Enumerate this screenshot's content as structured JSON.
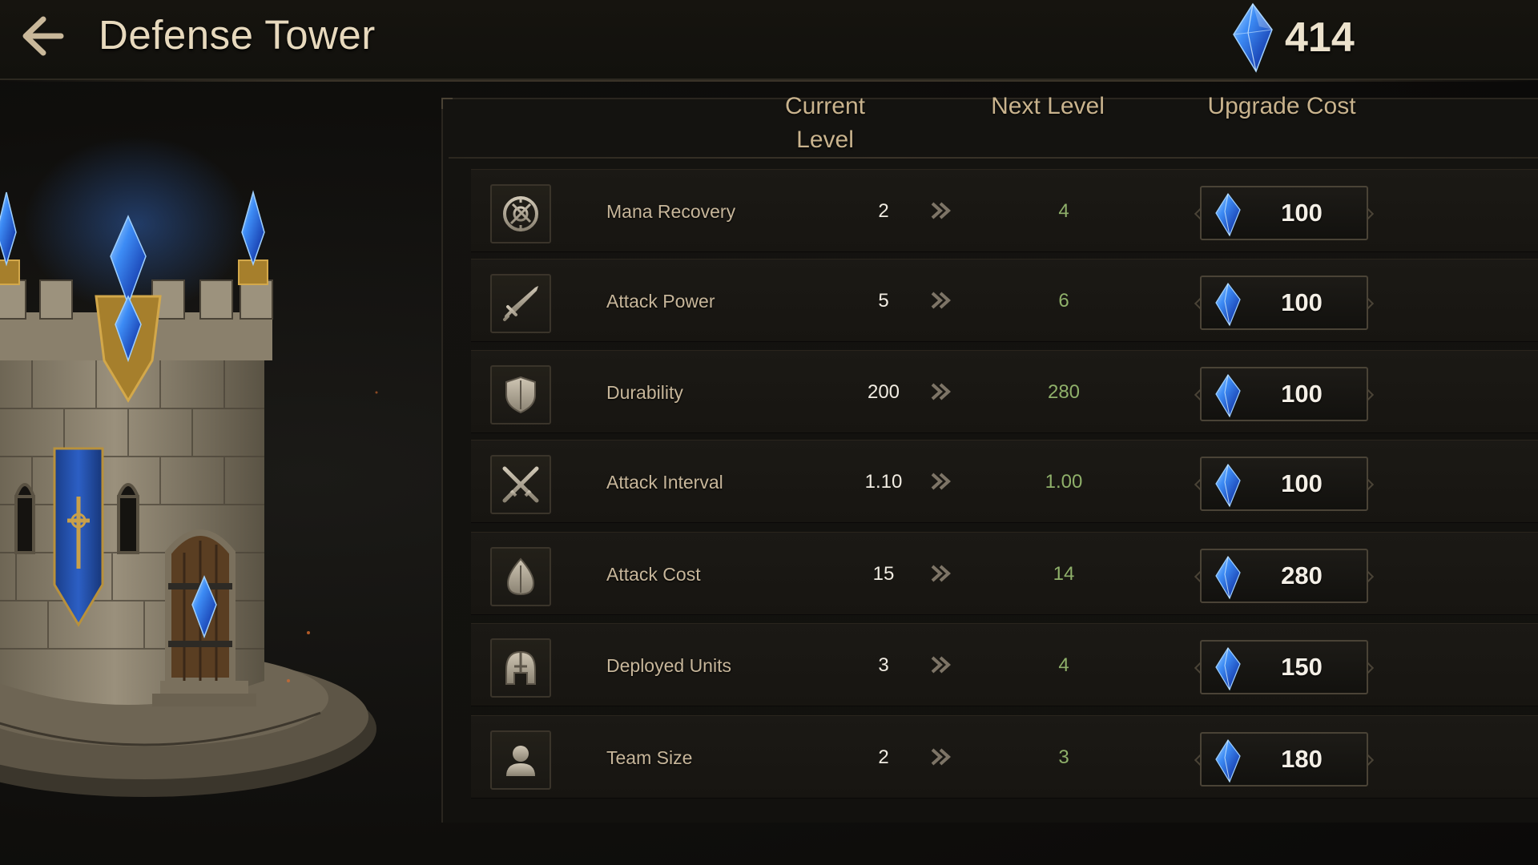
{
  "header": {
    "title": "Defense Tower",
    "currency_icon": "blue-crystal-icon",
    "currency_value": "414"
  },
  "table": {
    "headers": {
      "current": "Current Level",
      "next": "Next Level",
      "cost": "Upgrade Cost"
    },
    "rows": [
      {
        "icon": "mana-recovery-icon",
        "name": "Mana Recovery",
        "current": "2",
        "next": "4",
        "cost": "100"
      },
      {
        "icon": "sword-icon",
        "name": "Attack Power",
        "current": "5",
        "next": "6",
        "cost": "100"
      },
      {
        "icon": "shield-icon",
        "name": "Durability",
        "current": "200",
        "next": "280",
        "cost": "100"
      },
      {
        "icon": "crossed-swords-icon",
        "name": "Attack Interval",
        "current": "1.10",
        "next": "1.00",
        "cost": "100"
      },
      {
        "icon": "flame-drop-icon",
        "name": "Attack Cost",
        "current": "15",
        "next": "14",
        "cost": "280"
      },
      {
        "icon": "helmet-icon",
        "name": "Deployed Units",
        "current": "3",
        "next": "4",
        "cost": "150"
      },
      {
        "icon": "person-icon",
        "name": "Team Size",
        "current": "2",
        "next": "3",
        "cost": "180"
      }
    ]
  },
  "colors": {
    "next_value": "#8fb06a",
    "title": "#e7d9bd",
    "crystal": "#2f6fe0"
  }
}
